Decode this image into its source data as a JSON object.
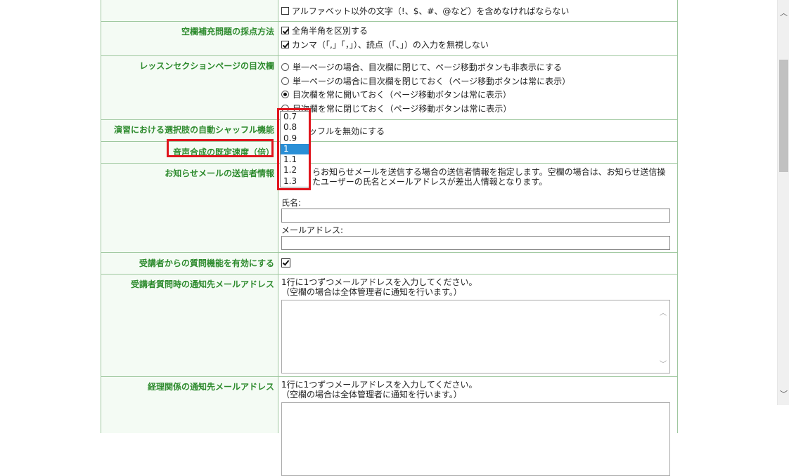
{
  "rows": {
    "r0": {
      "label": "",
      "options": [
        "アルファベット以外の文字（!、$、#、@など）を含めなければならない"
      ]
    },
    "r1": {
      "label": "空欄補充問題の採点方法",
      "options": [
        "全角半角を区別する",
        "カンマ（「,」「，」）、読点（「、」）の入力を無視しない"
      ]
    },
    "r2": {
      "label": "レッスンセクションページの目次欄",
      "options": [
        "単一ページの場合、目次欄に閉じて、ページ移動ボタンも非表示にする",
        "単一ページの場合に目次欄を閉じておく（ページ移動ボタンは常に表示）",
        "目次欄を常に開いておく（ページ移動ボタンは常に表示）",
        "目次欄を常に閉じておく（ページ移動ボタンは常に表示）"
      ]
    },
    "r3": {
      "label": "演習における選択肢の自動シャッフル機能",
      "option": "シャッフルを無効にする"
    },
    "r4": {
      "label": "音声合成の既定速度（倍）"
    },
    "r5": {
      "label": "お知らせメールの送信者情報",
      "desc1": "らお知らせメールを送信する場合の送信者情報を指定します。空欄の場合は、お知らせ送信操",
      "desc2": "たユーザーの氏名とメールアドレスが差出人情報となります。",
      "name_label": "氏名:",
      "email_label": "メールアドレス:"
    },
    "r6": {
      "label": "受講者からの質問機能を有効にする"
    },
    "r7": {
      "label": "受講者質問時の通知先メールアドレス",
      "desc1": "1行に1つずつメールアドレスを入力してください。",
      "desc2": "（空欄の場合は全体管理者に通知を行います。）"
    },
    "r8": {
      "label": "経理関係の通知先メールアドレス",
      "desc1": "1行に1つずつメールアドレスを入力してください。",
      "desc2": "（空欄の場合は全体管理者に通知を行います。）"
    }
  },
  "speed_dropdown": {
    "options": [
      "0.7",
      "0.8",
      "0.9",
      "1",
      "1.1",
      "1.2",
      "1.3"
    ],
    "selected": "1"
  }
}
